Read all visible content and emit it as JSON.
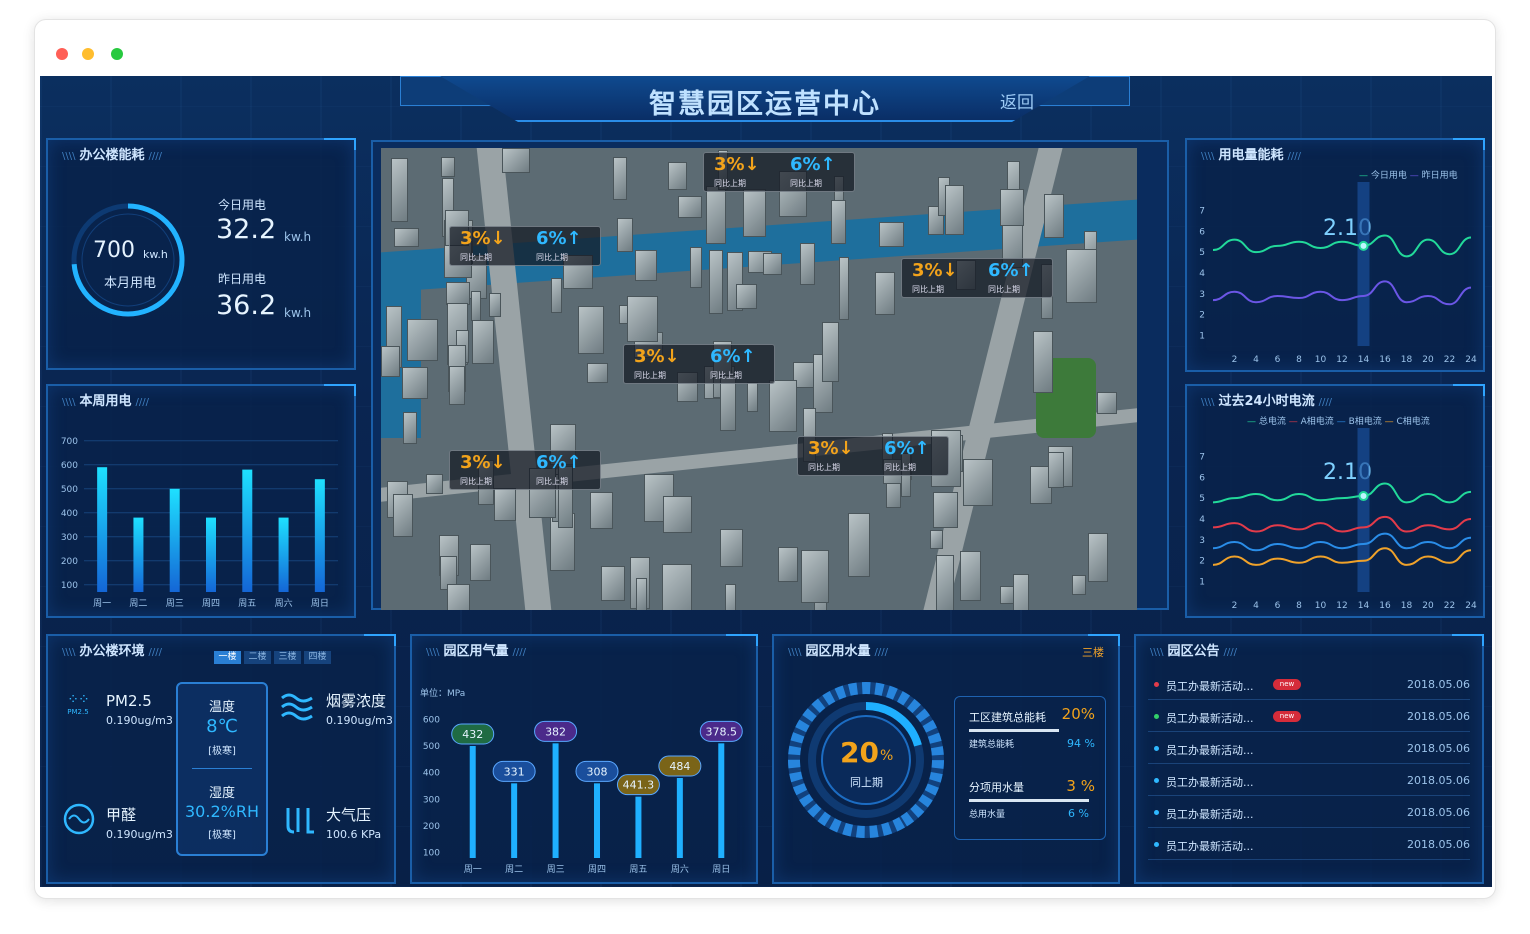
{
  "window": {
    "dots": [
      "#ff5f56",
      "#ffbd2e",
      "#27c93f"
    ]
  },
  "header": {
    "title": "智慧园区运营中心",
    "back_label": "返回"
  },
  "energy": {
    "title": "办公楼能耗",
    "gauge_value": "700",
    "gauge_unit": "kw.h",
    "gauge_label": "本月用电",
    "today_label": "今日用电",
    "today_value": "32.2",
    "today_unit": "kw.h",
    "yesterday_label": "昨日用电",
    "yesterday_value": "36.2",
    "yesterday_unit": "kw.h"
  },
  "week": {
    "title": "本周用电"
  },
  "elec": {
    "title": "用电量能耗",
    "legend_today": "今日用电",
    "legend_yesterday": "昨日用电",
    "highlight": "2.10"
  },
  "current": {
    "title": "过去24小时电流",
    "legend": [
      "总电流",
      "A相电流",
      "B相电流",
      "C相电流"
    ],
    "highlight": "2.10"
  },
  "map": {
    "tags": [
      {
        "down": "3%↓",
        "up": "6%↑",
        "sub": "同比上期"
      },
      {
        "down": "3%↓",
        "up": "6%↑",
        "sub": "同比上期"
      },
      {
        "down": "3%↓",
        "up": "6%↑",
        "sub": "同比上期"
      },
      {
        "down": "3%↓",
        "up": "6%↑",
        "sub": "同比上期"
      },
      {
        "down": "3%↓",
        "up": "6%↑",
        "sub": "同比上期"
      },
      {
        "down": "3%↓",
        "up": "6%↑",
        "sub": "同比上期"
      }
    ]
  },
  "env": {
    "title": "办公楼环境",
    "tabs": [
      "一楼",
      "二楼",
      "三楼",
      "四楼"
    ],
    "pm25_label": "PM2.5",
    "pm25_value": "0.190ug/m3",
    "pm25_icon_text": "PM2.5",
    "temp_label": "温度",
    "temp_value": "8℃",
    "temp_level": "[极寒]",
    "hum_label": "湿度",
    "hum_value": "30.2%RH",
    "hum_level": "[极寒]",
    "smoke_label": "烟雾浓度",
    "smoke_value": "0.190ug/m3",
    "hcho_label": "甲醛",
    "hcho_value": "0.190ug/m3",
    "press_label": "大气压",
    "press_value": "100.6 KPa"
  },
  "gas": {
    "title": "园区用气量",
    "unit": "单位：MPa"
  },
  "water": {
    "title": "园区用水量",
    "building": "三楼",
    "gauge_value": "20",
    "gauge_unit": "%",
    "gauge_label": "同上期",
    "row1_label": "工区建筑总能耗",
    "row1_value": "20%",
    "row1_sub": "建筑总能耗",
    "row1_sub_value": "94 %",
    "row2_label": "分项用水量",
    "row2_value": "3 %",
    "row2_sub": "总用水量",
    "row2_sub_value": "6 %"
  },
  "notices": {
    "title": "园区公告",
    "items": [
      {
        "text": "员工办最新活动...",
        "date": "2018.05.06",
        "badge": "new",
        "color": "#e23b4a"
      },
      {
        "text": "员工办最新活动...",
        "date": "2018.05.06",
        "badge": "new",
        "color": "#33d06a"
      },
      {
        "text": "员工办最新活动...",
        "date": "2018.05.06",
        "badge": "",
        "color": "#2fb8ff"
      },
      {
        "text": "员工办最新活动...",
        "date": "2018.05.06",
        "badge": "",
        "color": "#2fb8ff"
      },
      {
        "text": "员工办最新活动...",
        "date": "2018.05.06",
        "badge": "",
        "color": "#2fb8ff"
      },
      {
        "text": "员工办最新活动...",
        "date": "2018.05.06",
        "badge": "",
        "color": "#2fb8ff"
      }
    ]
  },
  "chart_data": [
    {
      "id": "week",
      "type": "bar",
      "categories": [
        "周一",
        "周二",
        "周三",
        "周四",
        "周五",
        "周六",
        "周日"
      ],
      "values": [
        590,
        380,
        500,
        380,
        580,
        380,
        540
      ],
      "yticks": [
        100,
        200,
        300,
        400,
        500,
        600,
        700
      ],
      "ylim": [
        70,
        720
      ]
    },
    {
      "id": "elec",
      "type": "line",
      "x": [
        0,
        2,
        4,
        6,
        8,
        10,
        12,
        14,
        16,
        18,
        20,
        22,
        24
      ],
      "xticks": [
        2,
        4,
        6,
        8,
        10,
        12,
        14,
        16,
        18,
        20,
        22,
        24
      ],
      "yticks": [
        1,
        2,
        3,
        4,
        5,
        6,
        7
      ],
      "ylim": [
        0.5,
        7.5
      ],
      "highlight_x": 14,
      "series": [
        {
          "name": "今日用电",
          "color": "#22d99a",
          "values": [
            5.1,
            5.6,
            5.0,
            5.3,
            5.5,
            5.2,
            5.5,
            5.3,
            5.8,
            4.8,
            5.6,
            4.9,
            5.7
          ]
        },
        {
          "name": "昨日用电",
          "color": "#6b56e6",
          "values": [
            2.7,
            3.1,
            2.6,
            2.9,
            2.8,
            3.1,
            2.7,
            2.9,
            3.6,
            2.6,
            2.9,
            2.5,
            3.3
          ]
        }
      ]
    },
    {
      "id": "current",
      "type": "line",
      "x": [
        0,
        2,
        4,
        6,
        8,
        10,
        12,
        14,
        16,
        18,
        20,
        22,
        24
      ],
      "xticks": [
        2,
        4,
        6,
        8,
        10,
        12,
        14,
        16,
        18,
        20,
        22,
        24
      ],
      "yticks": [
        1,
        2,
        3,
        4,
        5,
        6,
        7
      ],
      "ylim": [
        0.5,
        7.5
      ],
      "highlight_x": 14,
      "series": [
        {
          "name": "总电流",
          "color": "#22d99a",
          "values": [
            4.8,
            5.0,
            5.2,
            4.9,
            5.2,
            4.9,
            5.0,
            5.1,
            5.7,
            4.8,
            5.2,
            4.8,
            5.3
          ]
        },
        {
          "name": "A相电流",
          "color": "#e33b4a",
          "values": [
            3.6,
            3.8,
            3.4,
            3.7,
            3.5,
            3.8,
            3.4,
            3.6,
            4.1,
            3.4,
            3.7,
            3.5,
            4.0
          ]
        },
        {
          "name": "B相电流",
          "color": "#2a8de8",
          "values": [
            2.6,
            2.9,
            2.5,
            2.8,
            2.6,
            2.9,
            2.6,
            2.8,
            3.3,
            2.6,
            2.9,
            2.6,
            3.1
          ]
        },
        {
          "name": "C相电流",
          "color": "#f0a22a",
          "values": [
            1.8,
            2.2,
            1.8,
            2.1,
            1.9,
            2.2,
            1.9,
            2.0,
            2.6,
            1.8,
            2.2,
            1.9,
            2.5
          ]
        }
      ]
    },
    {
      "id": "gas",
      "type": "bar",
      "categories": [
        "周一",
        "周二",
        "周三",
        "周四",
        "周五",
        "周六",
        "周日"
      ],
      "values": [
        432,
        331,
        382,
        308,
        441.3,
        484,
        378.5
      ],
      "labels": [
        "432",
        "331",
        "382",
        "308",
        "441.3",
        "484",
        "378.5"
      ],
      "bar_heights": [
        500,
        360,
        510,
        360,
        310,
        380,
        510
      ],
      "bubble_colors": [
        "#1f6b43",
        "#1a4e9c",
        "#4b2a8a",
        "#1a4e9c",
        "#7a6418",
        "#7a6418",
        "#4b2a8a"
      ],
      "yticks": [
        100,
        200,
        300,
        400,
        500,
        600
      ],
      "ylim": [
        80,
        620
      ]
    }
  ]
}
